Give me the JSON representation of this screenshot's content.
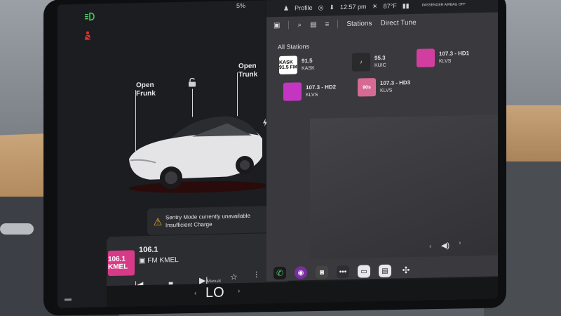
{
  "status": {
    "battery": "5%",
    "profile": "Profile",
    "time": "12:57 pm",
    "temp": "87°F",
    "passenger_airbag": "PASSENGER AIRBAG OFF"
  },
  "car": {
    "open_frunk": "Open Frunk",
    "open_trunk": "Open Trunk",
    "alert_title": "Sentry Mode currently unavailable",
    "alert_sub": "Insufficient Charge"
  },
  "media_player": {
    "freq": "106.1",
    "station": "FM KMEL",
    "logo_text": "106.1 KMEL"
  },
  "climate": {
    "mode": "Manual",
    "temp": "LO"
  },
  "radio": {
    "tab_stations": "Stations",
    "tab_direct": "Direct Tune",
    "section": "All Stations",
    "stations": [
      {
        "freq": "91.5",
        "call": "KASK",
        "logo": "KASK 91.5 FM",
        "color": "#ffffff"
      },
      {
        "freq": "95.3",
        "call": "KUIC",
        "logo": "♪",
        "color": "#2a2a2c"
      },
      {
        "freq": "107.3 - HD1",
        "call": "KLVS",
        "logo": "",
        "color": "#d23ea0"
      },
      {
        "freq": "107.3 - HD2",
        "call": "KLVS",
        "logo": "",
        "color": "#c436c2"
      },
      {
        "freq": "107.3 - HD3",
        "call": "KLVS",
        "logo": "90s",
        "color": "#d66a95"
      }
    ]
  },
  "colors": {
    "accent_green": "#3fd15a",
    "accent_red": "#e0312e",
    "warning_yellow": "#f2b52a"
  }
}
